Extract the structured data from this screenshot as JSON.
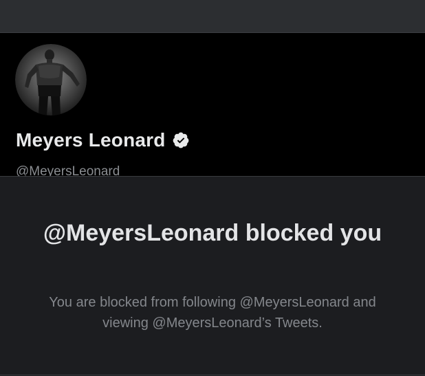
{
  "profile": {
    "display_name": "Meyers Leonard",
    "handle": "@MeyersLeonard",
    "verified": true,
    "verified_icon": "verified-badge-icon",
    "avatar": "profile-avatar-photo"
  },
  "blocked_notice": {
    "title": "@MeyersLeonard blocked you",
    "message": "You are blocked from following @MeyersLeonard and viewing @MeyersLeonard’s Tweets."
  },
  "colors": {
    "banner": "#2c2e31",
    "profile_background": "#000000",
    "page_background": "#1c1d20",
    "primary_text": "#e8e9ea",
    "secondary_text": "#8a8d91"
  }
}
